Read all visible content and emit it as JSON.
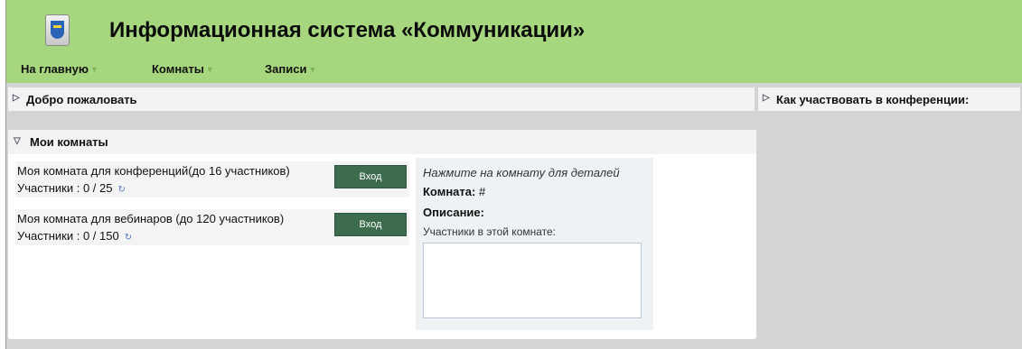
{
  "header": {
    "title": "Информационная система «Коммуникации»",
    "nav": [
      {
        "label": "На главную"
      },
      {
        "label": "Комнаты"
      },
      {
        "label": "Записи"
      }
    ]
  },
  "welcome_panel": {
    "title": "Добро пожаловать"
  },
  "conference_panel": {
    "title": "Как участвовать в конференции:"
  },
  "rooms_panel": {
    "title": "Мои комнаты",
    "rooms": [
      {
        "name": "Моя комната для конференций(до 16 участников)",
        "participants": "Участники : 0 / 25",
        "enter_label": "Вход"
      },
      {
        "name": "Моя комната для вебинаров (до 120 участников)",
        "participants": "Участники : 0 / 150",
        "enter_label": "Вход"
      }
    ],
    "details": {
      "hint": "Нажмите на комнату для деталей",
      "room_label": "Комната:",
      "room_value": "#",
      "description_label": "Описание:",
      "participants_label": "Участники в этой комнате:",
      "participants_value": ""
    }
  },
  "colors": {
    "header_bg": "#a6d67e",
    "enter_button": "#3d6b4e",
    "caret": "#7fb25a"
  }
}
